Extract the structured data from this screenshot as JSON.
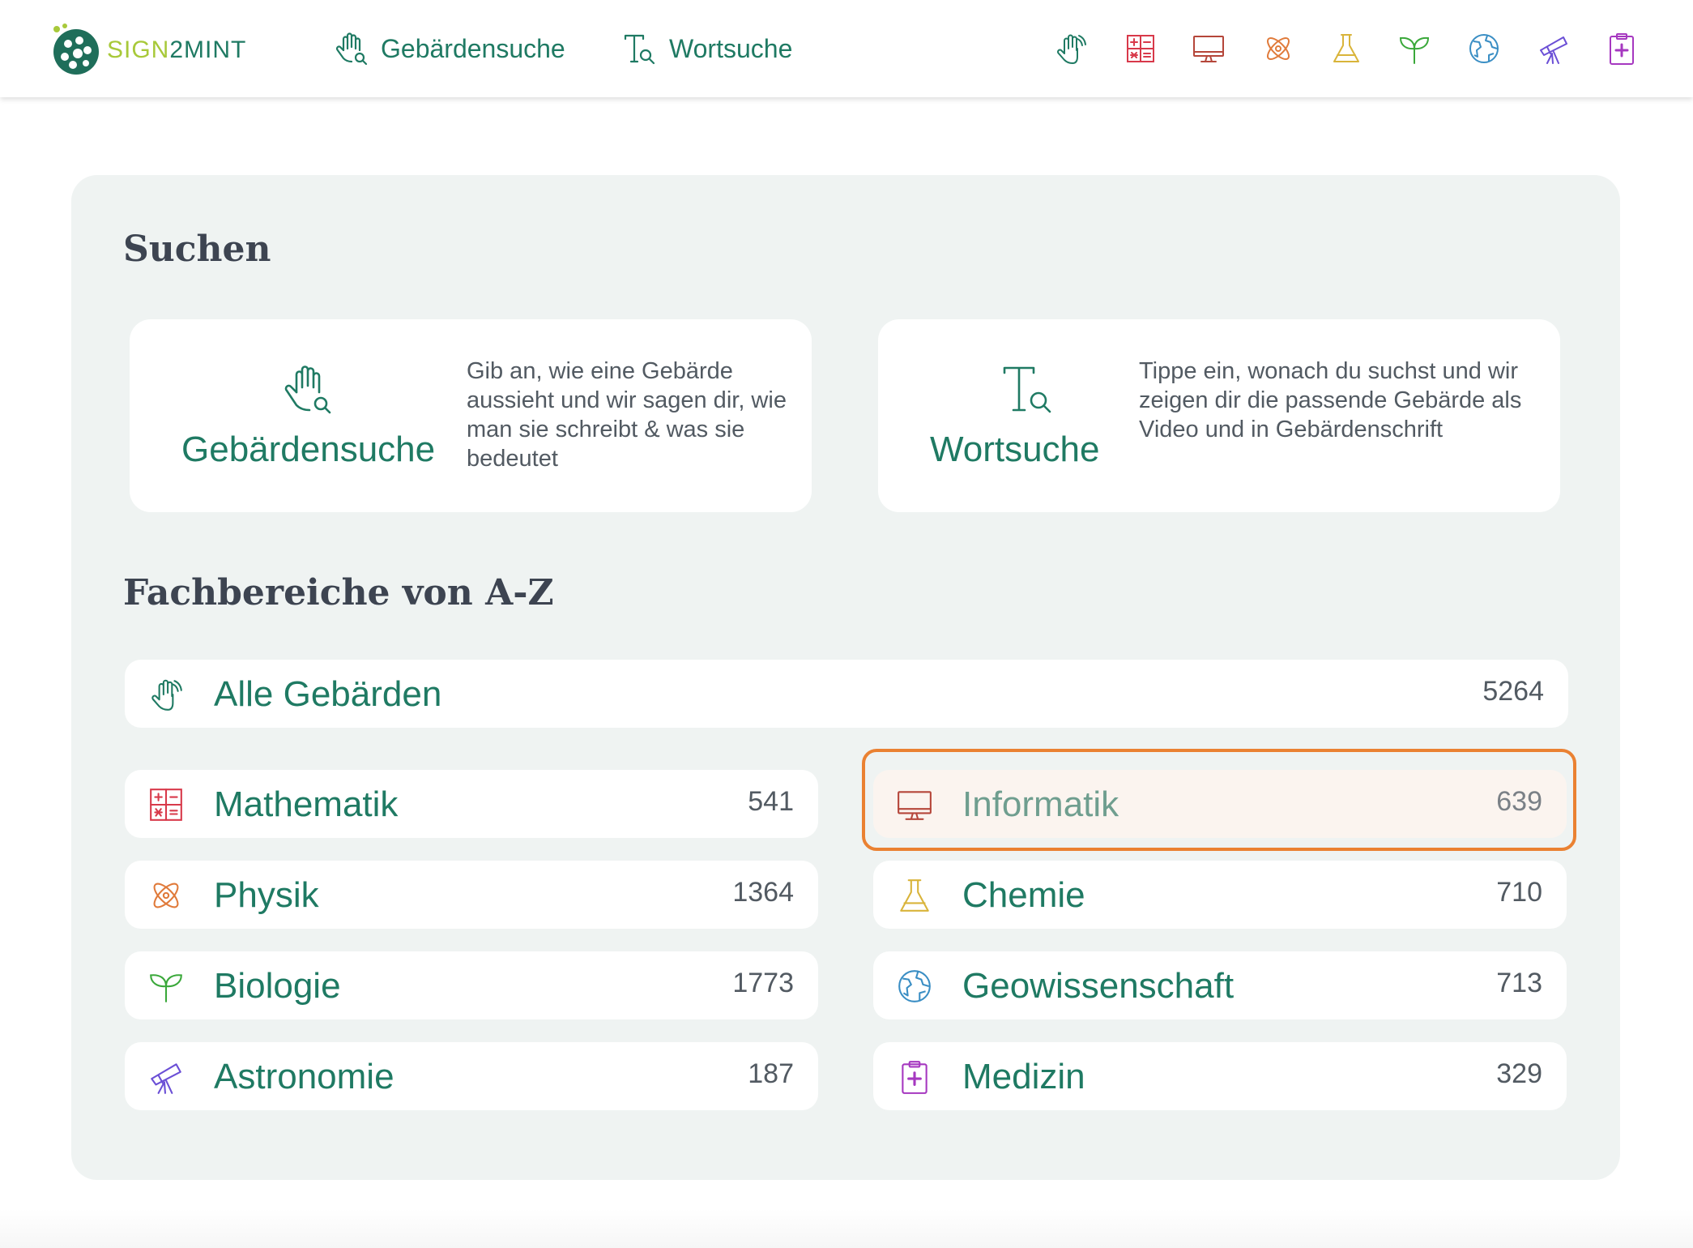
{
  "header": {
    "logo_text_a": "SIGN",
    "logo_text_b": "2",
    "logo_text_c": "MINT",
    "nav": [
      {
        "label": "Gebärdensuche",
        "icon": "hand-search-icon"
      },
      {
        "label": "Wortsuche",
        "icon": "text-search-icon"
      }
    ],
    "subject_icons": [
      {
        "name": "alle-gebaerden",
        "color": "#1f7a63"
      },
      {
        "name": "mathematik",
        "color": "#d8394a"
      },
      {
        "name": "informatik",
        "color": "#b5463a"
      },
      {
        "name": "physik",
        "color": "#e07a3a"
      },
      {
        "name": "chemie",
        "color": "#d9b43a"
      },
      {
        "name": "biologie",
        "color": "#3aa83a"
      },
      {
        "name": "geowissenschaft",
        "color": "#3a8ec4"
      },
      {
        "name": "astronomie",
        "color": "#6b4fd6"
      },
      {
        "name": "medizin",
        "color": "#a638c0"
      }
    ]
  },
  "main": {
    "search_title": "Suchen",
    "search_cards": [
      {
        "title": "Gebärdensuche",
        "description": "Gib an, wie eine Gebärde aussieht und wir sagen dir, wie man sie schreibt & was sie bedeutet"
      },
      {
        "title": "Wortsuche",
        "description": "Tippe ein, wonach du suchst und wir zeigen dir die passende Gebärde als Video und in Gebärdenschrift"
      }
    ],
    "subjects_title": "Fachbereiche von A-Z",
    "all_signs": {
      "label": "Alle Gebärden",
      "count": "5264"
    },
    "subjects": [
      {
        "label": "Mathematik",
        "count": "541",
        "color": "#d8394a"
      },
      {
        "label": "Informatik",
        "count": "639",
        "color": "#b5463a",
        "highlighted": true
      },
      {
        "label": "Physik",
        "count": "1364",
        "color": "#e07a3a"
      },
      {
        "label": "Chemie",
        "count": "710",
        "color": "#d9b43a"
      },
      {
        "label": "Biologie",
        "count": "1773",
        "color": "#3aa83a"
      },
      {
        "label": "Geowissenschaft",
        "count": "713",
        "color": "#3a8ec4"
      },
      {
        "label": "Astronomie",
        "count": "187",
        "color": "#6b4fd6"
      },
      {
        "label": "Medizin",
        "count": "329",
        "color": "#a638c0"
      }
    ]
  },
  "colors": {
    "brand": "#1f7a63",
    "accent_green": "#a8c93a",
    "focus": "#ea8132",
    "panel": "#eff3f2"
  }
}
